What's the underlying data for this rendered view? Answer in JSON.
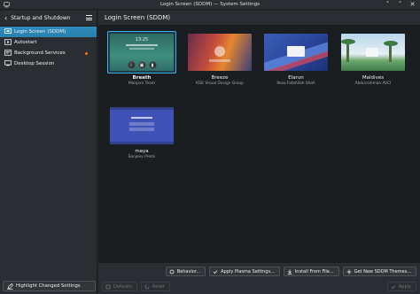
{
  "window": {
    "title": "Login Screen (SDDM) — System Settings",
    "icon": "system-settings-icon",
    "buttons": {
      "minimize": "˅",
      "maximize": "˄",
      "close": "✕"
    }
  },
  "sidebar": {
    "header": "Startup and Shutdown",
    "back_icon": "‹",
    "items": [
      {
        "label": "Login Screen (SDDM)",
        "icon": "login-screen-icon",
        "selected": true
      },
      {
        "label": "Autostart",
        "icon": "autostart-icon"
      },
      {
        "label": "Background Services",
        "icon": "background-services-icon",
        "badge": true
      },
      {
        "label": "Desktop Session",
        "icon": "desktop-session-icon"
      }
    ],
    "footer_button": "Highlight Changed Settings"
  },
  "main": {
    "title": "Login Screen (SDDM)",
    "themes": [
      {
        "name": "Breath",
        "author": "Manjaro Team",
        "selected": true,
        "preview_time": "13:25"
      },
      {
        "name": "Breeze",
        "author": "KDE Visual Design Group"
      },
      {
        "name": "Elarun",
        "author": "Reza Fatahilah Shah"
      },
      {
        "name": "Maldives",
        "author": "Abdurrahman AVCI"
      },
      {
        "name": "maya",
        "author": "Sanjeev Premi"
      }
    ]
  },
  "bottombar": {
    "behavior": "Behavior...",
    "apply_plasma": "Apply Plasma Settings...",
    "install_file": "Install From File...",
    "get_new": "Get New SDDM Themes...",
    "defaults": "Defaults",
    "reset": "Reset",
    "apply": "Apply"
  },
  "colors": {
    "accent": "#3daee9",
    "selected_bg": "#2a7fab",
    "badge": "#f67400"
  }
}
